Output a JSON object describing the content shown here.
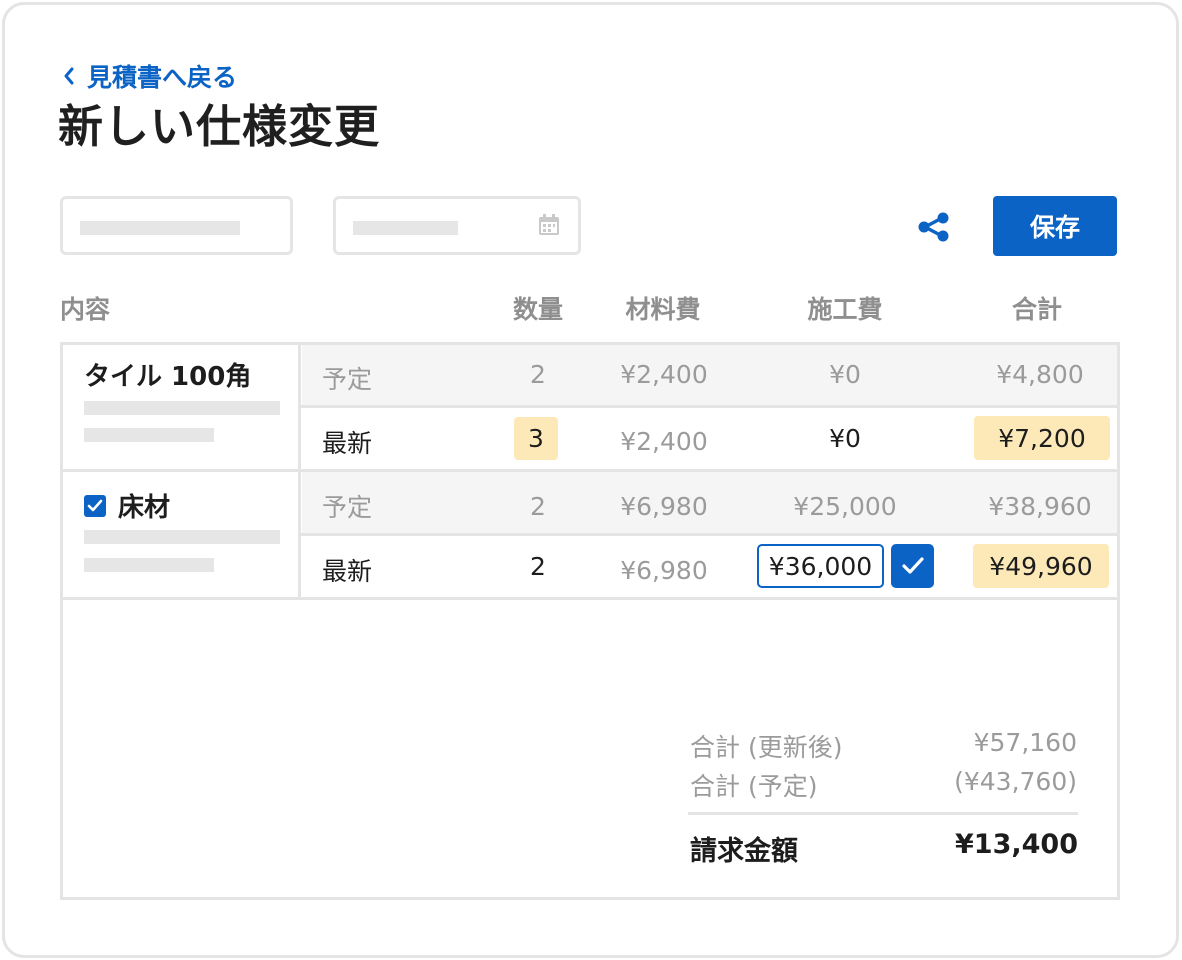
{
  "nav": {
    "back_label": "見積書へ戻る"
  },
  "page": {
    "title": "新しい仕様変更"
  },
  "toolbar": {
    "save_label": "保存"
  },
  "columns": {
    "content": "内容",
    "quantity": "数量",
    "material": "材料費",
    "labor": "施工費",
    "total": "合計"
  },
  "items": [
    {
      "name": "タイル 100角",
      "checked": false,
      "planned": {
        "label": "予定",
        "quantity": "2",
        "material": "¥2,400",
        "labor": "¥0",
        "total": "¥4,800"
      },
      "latest": {
        "label": "最新",
        "quantity": "3",
        "material": "¥2,400",
        "labor": "¥0",
        "total": "¥7,200"
      }
    },
    {
      "name": "床材",
      "checked": true,
      "planned": {
        "label": "予定",
        "quantity": "2",
        "material": "¥6,980",
        "labor": "¥25,000",
        "total": "¥38,960"
      },
      "latest": {
        "label": "最新",
        "quantity": "2",
        "material": "¥6,980",
        "labor": "¥36,000",
        "total": "¥49,960"
      }
    }
  ],
  "summary": {
    "updated_label": "合計 (更新後)",
    "updated_value": "¥57,160",
    "planned_label": "合計 (予定)",
    "planned_value": "(¥43,760)",
    "billing_label": "請求金額",
    "billing_value": "¥13,400"
  },
  "colors": {
    "accent": "#0b63c5",
    "highlight": "#fde9b8",
    "border": "#e4e4e4",
    "muted_text": "#9b9b9b"
  },
  "icons": [
    "chevron-left-icon",
    "calendar-icon",
    "share-icon",
    "checkbox-checked-icon",
    "checkmark-icon"
  ]
}
